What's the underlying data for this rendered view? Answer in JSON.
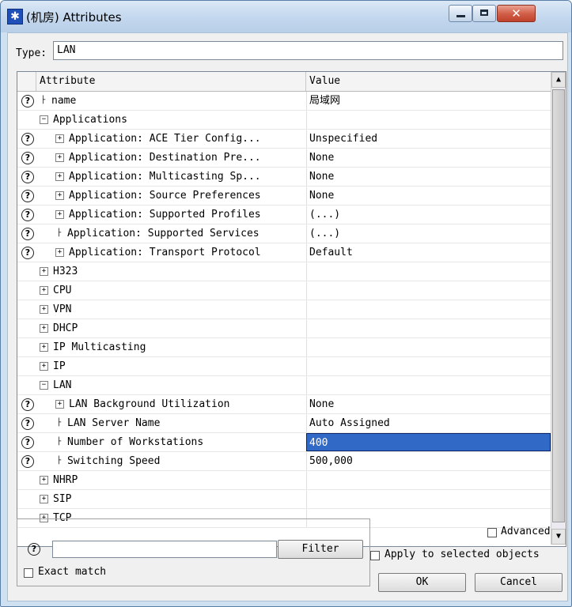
{
  "window": {
    "title": "(机房) Attributes",
    "controls": {
      "minimize": "minimize",
      "maximize": "maximize",
      "close": "close"
    }
  },
  "type": {
    "label": "Type:",
    "value": "LAN"
  },
  "grid": {
    "header": {
      "attribute": "Attribute",
      "value": "Value"
    },
    "rows": [
      {
        "name": "name",
        "value": "局域网",
        "help": true,
        "expander": "line",
        "indent": 0
      },
      {
        "name": "Applications",
        "value": "",
        "help": false,
        "expander": "minus",
        "indent": 0
      },
      {
        "name": "Application: ACE Tier Config...",
        "value": "Unspecified",
        "help": true,
        "expander": "plus",
        "indent": 1
      },
      {
        "name": "Application: Destination Pre...",
        "value": "None",
        "help": true,
        "expander": "plus",
        "indent": 1
      },
      {
        "name": "Application: Multicasting Sp...",
        "value": "None",
        "help": true,
        "expander": "plus",
        "indent": 1
      },
      {
        "name": "Application: Source Preferences",
        "value": "None",
        "help": true,
        "expander": "plus",
        "indent": 1
      },
      {
        "name": "Application: Supported Profiles",
        "value": "(...)",
        "help": true,
        "expander": "plus",
        "indent": 1
      },
      {
        "name": "Application: Supported Services",
        "value": "(...)",
        "help": true,
        "expander": "line",
        "indent": 1
      },
      {
        "name": "Application: Transport Protocol",
        "value": "Default",
        "help": true,
        "expander": "plus",
        "indent": 1
      },
      {
        "name": "H323",
        "value": "",
        "help": false,
        "expander": "plus",
        "indent": 0
      },
      {
        "name": "CPU",
        "value": "",
        "help": false,
        "expander": "plus",
        "indent": 0
      },
      {
        "name": "VPN",
        "value": "",
        "help": false,
        "expander": "plus",
        "indent": 0
      },
      {
        "name": "DHCP",
        "value": "",
        "help": false,
        "expander": "plus",
        "indent": 0
      },
      {
        "name": "IP Multicasting",
        "value": "",
        "help": false,
        "expander": "plus",
        "indent": 0
      },
      {
        "name": "IP",
        "value": "",
        "help": false,
        "expander": "plus",
        "indent": 0
      },
      {
        "name": "LAN",
        "value": "",
        "help": false,
        "expander": "minus",
        "indent": 0
      },
      {
        "name": "LAN Background Utilization",
        "value": "None",
        "help": true,
        "expander": "plus",
        "indent": 1
      },
      {
        "name": "LAN Server Name",
        "value": "Auto Assigned",
        "help": true,
        "expander": "line",
        "indent": 1
      },
      {
        "name": "Number of Workstations",
        "value": "400",
        "help": true,
        "expander": "line",
        "indent": 1,
        "selected": true
      },
      {
        "name": "Switching Speed",
        "value": "500,000",
        "help": true,
        "expander": "line",
        "indent": 1
      },
      {
        "name": "NHRP",
        "value": "",
        "help": false,
        "expander": "plus",
        "indent": 0
      },
      {
        "name": "SIP",
        "value": "",
        "help": false,
        "expander": "plus",
        "indent": 0
      },
      {
        "name": "TCP",
        "value": "",
        "help": false,
        "expander": "plus",
        "indent": 0
      }
    ]
  },
  "filter": {
    "input_value": "",
    "button": "Filter",
    "exact_match": "Exact match"
  },
  "options": {
    "advanced": "Advanced",
    "apply_selected": "Apply to selected objects"
  },
  "buttons": {
    "ok": "OK",
    "cancel": "Cancel"
  }
}
